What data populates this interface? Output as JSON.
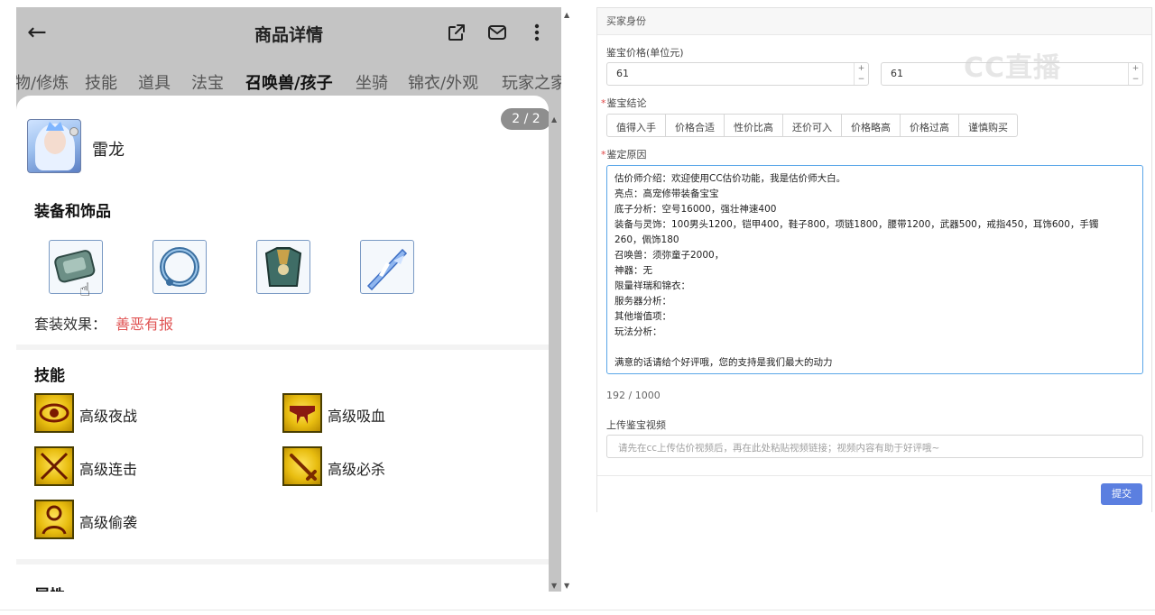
{
  "left": {
    "header": {
      "back": "←",
      "title": "商品详情"
    },
    "tabs": [
      "物/修炼",
      "技能",
      "道具",
      "法宝",
      "召唤兽/孩子",
      "坐骑",
      "锦衣/外观",
      "玩家之家"
    ],
    "page_badge": "2 / 2",
    "pet": {
      "name": "雷龙"
    },
    "equipment": {
      "title": "装备和饰品",
      "suit_label": "套装效果：",
      "suit_value": "善恶有报"
    },
    "skills": {
      "title": "技能",
      "items": [
        {
          "label": "高级夜战",
          "icon": "eye-icon"
        },
        {
          "label": "高级吸血",
          "icon": "fang-icon"
        },
        {
          "label": "高级连击",
          "icon": "crossed-swords-icon"
        },
        {
          "label": "高级必杀",
          "icon": "sword-icon"
        },
        {
          "label": "高级偷袭",
          "icon": "assassin-icon"
        }
      ]
    },
    "attributes": {
      "title": "属性"
    }
  },
  "right": {
    "form_title": "买家身份",
    "price": {
      "label": "鉴宝价格(单位元)",
      "min": "61",
      "max": "61"
    },
    "conclusion": {
      "label": "鉴宝结论",
      "options": [
        "值得入手",
        "价格合适",
        "性价比高",
        "还价可入",
        "价格略高",
        "价格过高",
        "谨慎购买"
      ]
    },
    "reason": {
      "label": "鉴定原因",
      "lines": [
        "估价师介绍：欢迎使用CC估价功能，我是估价师大白。",
        "亮点：高宠修带装备宝宝",
        "底子分析：空号16000，强壮神速400",
        "装备与灵饰：100男头1200，铠甲400，鞋子800，项链1800，腰带1200，武器500，戒指450，耳饰600，手镯",
        "260，佩饰180",
        "召唤兽：须弥童子2000，",
        "神器：无",
        "限量祥瑞和锦衣：",
        "服务器分析：",
        "其他增值项：",
        "玩法分析：",
        "",
        "满意的话请给个好评哦，您的支持是我们最大的动力"
      ],
      "counter": "192 / 1000"
    },
    "video": {
      "label": "上传鉴宝视频",
      "placeholder": "请先在cc上传估价视频后，再在此处粘贴视频链接；视频内容有助于好评哦~"
    },
    "submit": "提交",
    "watermark": "CC直播"
  }
}
